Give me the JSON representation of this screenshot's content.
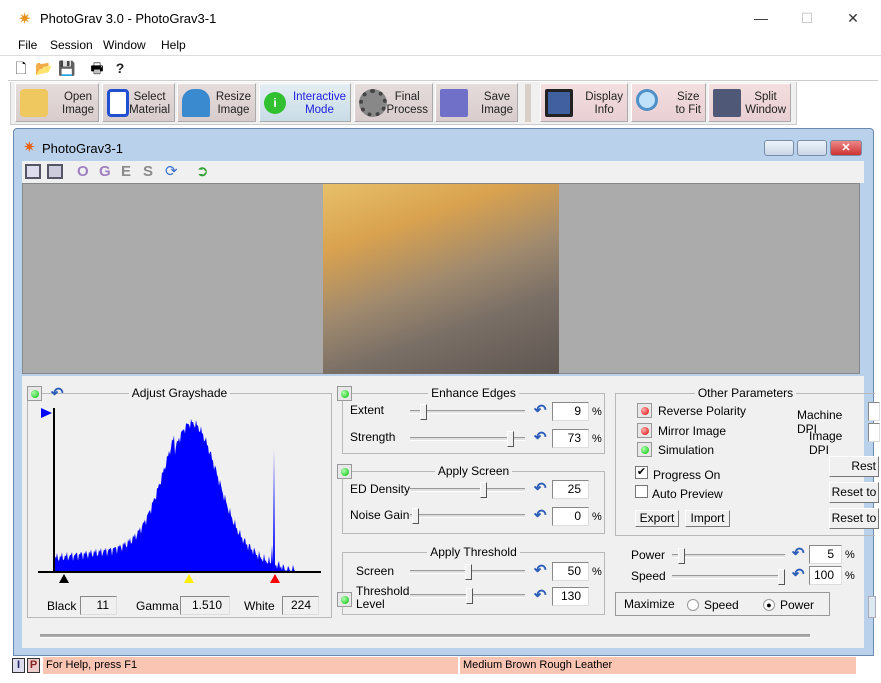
{
  "window": {
    "title": "PhotoGrav 3.0 - PhotoGrav3-1",
    "minimize": "—",
    "maximize": "☐",
    "close": "✕"
  },
  "menu": [
    "File",
    "Session",
    "Window",
    "Help"
  ],
  "small_toolbar": [
    {
      "icon": "new-document-icon",
      "glyph": "🗋"
    },
    {
      "icon": "open-folder-icon",
      "glyph": "📂"
    },
    {
      "icon": "save-disk-icon",
      "glyph": "💾"
    },
    {
      "icon": "print-icon",
      "glyph": "🖶"
    },
    {
      "icon": "help-icon",
      "glyph": "?"
    }
  ],
  "toolbar": [
    {
      "label1": "Open",
      "label2": "Image",
      "icon": "open-image-icon",
      "color": "#f0c860"
    },
    {
      "label1": "Select",
      "label2": "Material",
      "icon": "select-material-icon",
      "color": "#2050d0"
    },
    {
      "label1": "Resize",
      "label2": "Image",
      "icon": "resize-image-icon",
      "color": "#3a8ad0"
    },
    {
      "label1": "Interactive",
      "label2": "Mode",
      "icon": "info-icon",
      "color": "#30c030"
    },
    {
      "label1": "Final",
      "label2": "Process",
      "icon": "gear-icon",
      "color": "#888888"
    },
    {
      "label1": "Save",
      "label2": "Image",
      "icon": "floppy-disk-icon",
      "color": "#7070c8"
    },
    {
      "label1": "Display",
      "label2": "Info",
      "icon": "monitor-icon",
      "color": "#4060a0"
    },
    {
      "label1": "Size",
      "label2": "to Fit",
      "icon": "magnifier-icon",
      "color": "#80c0f0"
    },
    {
      "label1": "Split",
      "label2": "Window",
      "icon": "split-window-icon",
      "color": "#505878"
    }
  ],
  "child": {
    "title": "PhotoGrav3-1",
    "toolbar": [
      "O",
      "G",
      "E",
      "S"
    ]
  },
  "grayshade": {
    "title": "Adjust Grayshade",
    "black_label": "Black",
    "black": "11",
    "gamma_label": "Gamma",
    "gamma": "1.510",
    "white_label": "White",
    "white": "224",
    "enabled": true
  },
  "enhance_edges": {
    "title": "Enhance Edges",
    "extent_label": "Extent",
    "extent": "9",
    "extent_pct": 9,
    "strength_label": "Strength",
    "strength": "73",
    "strength_pct": 88,
    "unit": "%"
  },
  "apply_screen": {
    "title": "Apply Screen",
    "ed_label": "ED Density",
    "ed": "25",
    "noise_label": "Noise Gain",
    "noise": "0",
    "unit": "%"
  },
  "apply_threshold": {
    "title": "Apply Threshold",
    "screen_label": "Screen",
    "screen": "50",
    "level_label1": "Threshold",
    "level_label2": "Level",
    "level": "130",
    "unit": "%"
  },
  "other": {
    "title": "Other Parameters",
    "reverse": "Reverse Polarity",
    "mirror": "Mirror Image",
    "simulation": "Simulation",
    "machine_dpi": "Machine DPI",
    "image_dpi": "Image DPI",
    "progress": "Progress On",
    "progress_checked": true,
    "auto_preview": "Auto Preview",
    "auto_checked": false,
    "export": "Export",
    "import": "Import",
    "rest": "Rest",
    "reset1": "Reset to",
    "reset2": "Reset to"
  },
  "power": {
    "label": "Power",
    "value": "5",
    "unit": "%"
  },
  "speed": {
    "label": "Speed",
    "value": "100",
    "unit": "%"
  },
  "maximize": {
    "label": "Maximize",
    "speed": "Speed",
    "power": "Power",
    "selected": "Power"
  },
  "status": {
    "i": "I",
    "p": "P",
    "help": "For Help, press F1",
    "material": "Medium Brown Rough Leather"
  }
}
